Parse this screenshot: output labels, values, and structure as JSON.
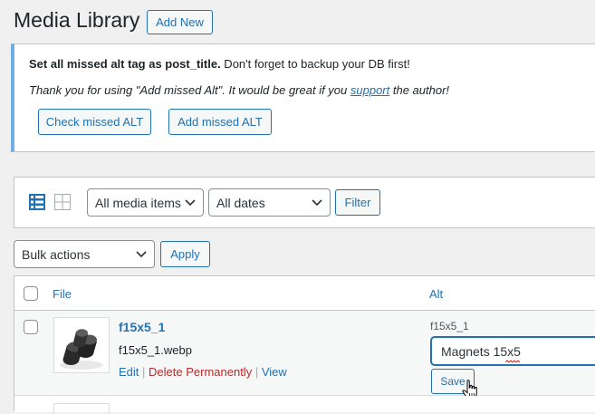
{
  "header": {
    "title": "Media Library",
    "add_new_label": "Add New"
  },
  "notice": {
    "bold_text": "Set all missed alt tag as post_title.",
    "rest_text": " Don't forget to backup your DB first!",
    "thanks_pre": "Thank you for using \"Add missed Alt\". It would be great if you ",
    "support_link": "support",
    "thanks_post": " the author!",
    "check_button": "Check missed ALT",
    "add_button": "Add missed ALT"
  },
  "filters": {
    "media_type_selected": "All media items",
    "date_selected": "All dates",
    "filter_button": "Filter"
  },
  "bulk": {
    "selected": "Bulk actions",
    "apply_button": "Apply"
  },
  "table": {
    "columns": {
      "file": "File",
      "alt": "Alt"
    },
    "rows": [
      {
        "title": "f15x5_1",
        "filename": "f15x5_1.webp",
        "actions": {
          "edit": "Edit",
          "delete": "Delete Permanently",
          "view": "View"
        },
        "alt_current": "f15x5_1",
        "alt_input_value": "Magnets 15x5",
        "save_label": "Save"
      }
    ]
  },
  "icons": [
    "list-view-icon",
    "grid-view-icon",
    "chevron-down-icon",
    "hand-cursor-icon"
  ],
  "colors": {
    "accent": "#2271b1",
    "notice_border": "#72aee6",
    "delete": "#b32d2e"
  }
}
